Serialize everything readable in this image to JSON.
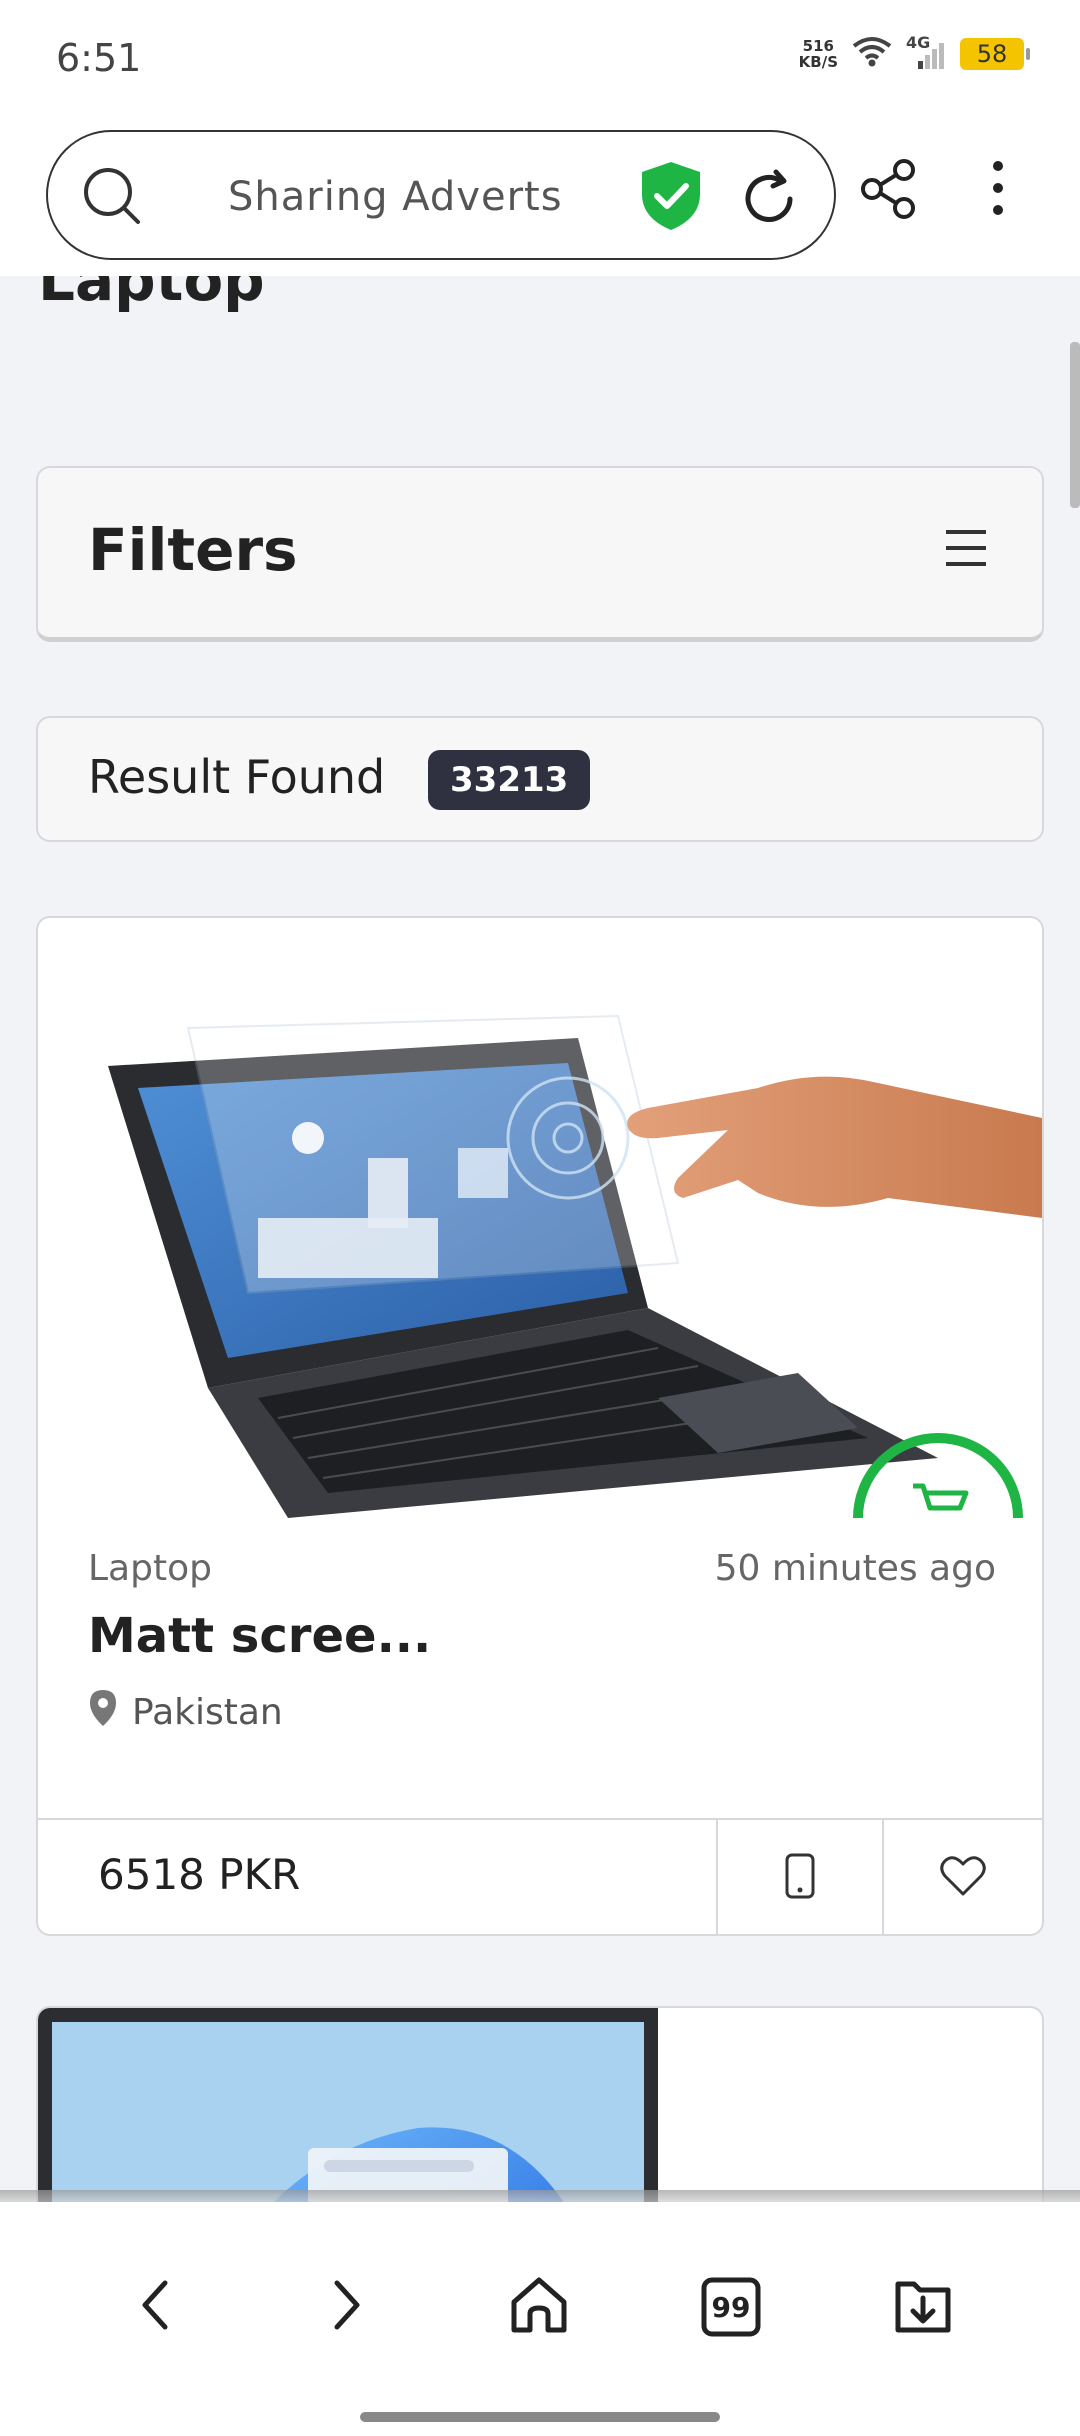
{
  "status_bar": {
    "time": "6:51",
    "net_speed_value": "516",
    "net_speed_unit": "KB/S",
    "network_type": "4G",
    "battery": "58"
  },
  "address_bar": {
    "url_text": "Sharing Adverts",
    "icons": [
      "search-icon",
      "shield-check-icon",
      "reload-icon",
      "share-icon",
      "more-vert-icon"
    ]
  },
  "page": {
    "heading": "Laptop",
    "filters": {
      "title": "Filters"
    },
    "results": {
      "label": "Result Found",
      "count": "33213"
    },
    "ads": [
      {
        "category": "Laptop",
        "time_ago": "50 minutes ago",
        "title": "Matt scree...",
        "location": "Pakistan",
        "price": "6518 PKR"
      }
    ]
  },
  "bottom_nav": {
    "items": [
      "back-icon",
      "forward-icon",
      "home-icon",
      "tabs-icon",
      "downloads-icon"
    ],
    "tabs_count": "99"
  },
  "colors": {
    "accent_green": "#1fb545",
    "badge_dark": "#2f3140"
  }
}
